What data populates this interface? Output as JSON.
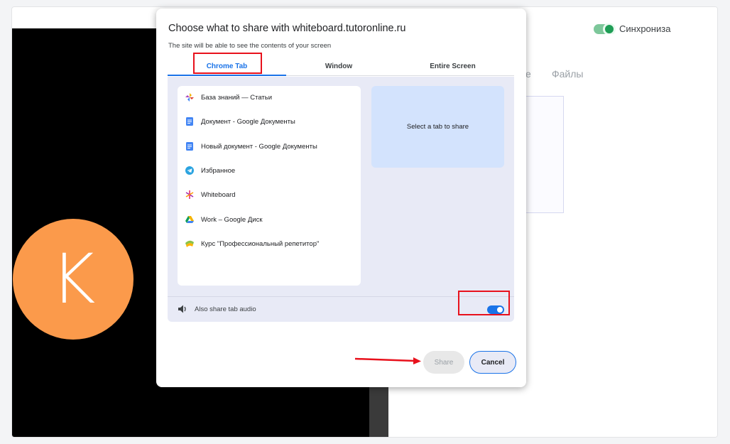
{
  "background": {
    "avatar_letter": "K",
    "sync_label": "Синхрониза",
    "tab_partial": "е",
    "tab_files": "Файлы"
  },
  "dialog": {
    "title": "Choose what to share with whiteboard.tutoronline.ru",
    "subtitle": "The site will be able to see the contents of your screen",
    "tabs": [
      {
        "label": "Chrome Tab",
        "active": true
      },
      {
        "label": "Window",
        "active": false
      },
      {
        "label": "Entire Screen",
        "active": false
      }
    ],
    "tab_list": [
      {
        "label": "База знаний — Статьи",
        "icon": "pinwheel-icon"
      },
      {
        "label": "Документ - Google Документы",
        "icon": "google-docs-icon"
      },
      {
        "label": "Новый документ - Google Документы",
        "icon": "google-docs-icon"
      },
      {
        "label": "Избранное",
        "icon": "telegram-icon"
      },
      {
        "label": "Whiteboard",
        "icon": "whiteboard-logo-icon"
      },
      {
        "label": "Work – Google Диск",
        "icon": "google-drive-icon"
      },
      {
        "label": "Курс \"Профессиональный репетитор\"",
        "icon": "course-logo-icon"
      }
    ],
    "preview_text": "Select a tab to share",
    "audio_label": "Also share tab audio",
    "audio_enabled": true,
    "share_label": "Share",
    "cancel_label": "Cancel"
  },
  "colors": {
    "accent": "#1a73e8",
    "annotation": "#e8111c",
    "avatar": "#fb9a4b",
    "sync_green": "#1e9d55"
  }
}
